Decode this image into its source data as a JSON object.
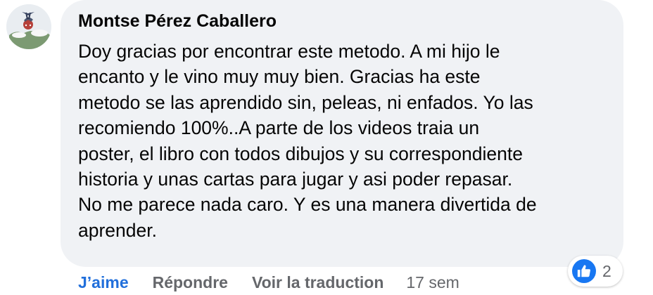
{
  "comment": {
    "author": "Montse Pérez Caballero",
    "text_lines": [
      "Doy gracias por encontrar este metodo. A mi hijo le",
      "encanto y le vino muy muy bien. Gracias ha este",
      "metodo se las aprendido sin, peleas, ni enfados. Yo las",
      "recomiendo 100%..A parte de los videos traia un",
      "poster, el libro con todos dibujos y su correspondiente",
      "historia y unas cartas para jugar y asi poder repasar.",
      "No me parece nada caro. Y es una manera divertida de",
      "aprender."
    ],
    "reaction_icon": "like-thumbs-up-icon",
    "reaction_count": "2"
  },
  "actions": {
    "like_label": "J’aime",
    "reply_label": "Répondre",
    "translate_label": "Voir la traduction",
    "timestamp": "17 sem"
  },
  "colors": {
    "bubble_bg": "#f0f2f5",
    "like_blue": "#216fdb",
    "secondary_text": "#65676b",
    "primary_text": "#050505"
  }
}
